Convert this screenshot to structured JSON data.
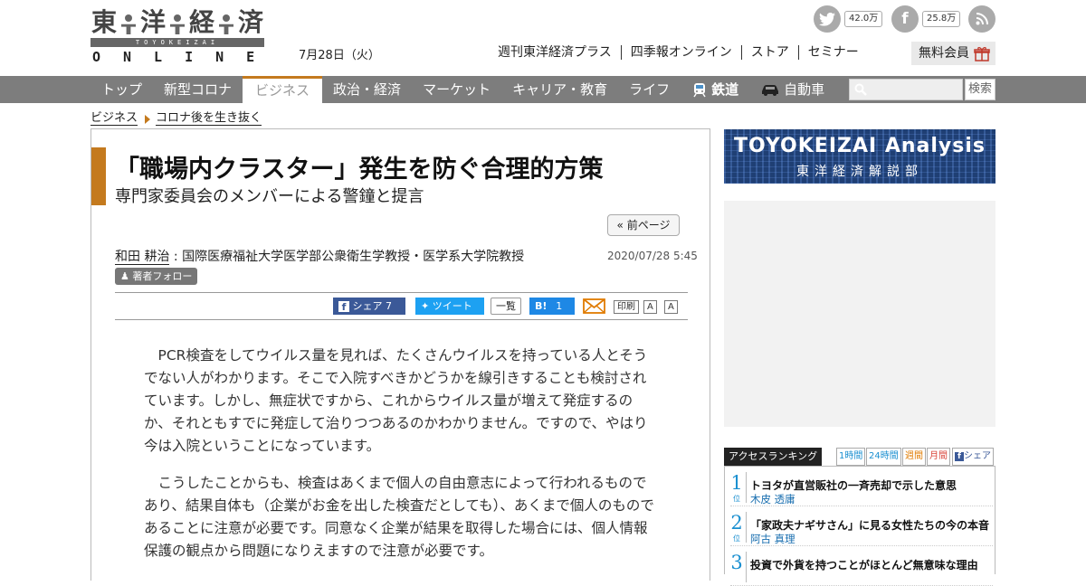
{
  "header": {
    "logo": {
      "chars": [
        "東",
        "洋",
        "経",
        "済"
      ],
      "roman": "TOYOKEIZAI",
      "sub": "ONLINE"
    },
    "date": "7月28日（火）",
    "links": [
      "週刊東洋経済プラス",
      "四季報オンライン",
      "ストア",
      "セミナー"
    ],
    "member_button": "無料会員",
    "social": [
      {
        "icon": "twitter-icon",
        "count": "42.0万"
      },
      {
        "icon": "facebook-icon",
        "count": "25.8万"
      },
      {
        "icon": "rss-icon",
        "count": ""
      }
    ]
  },
  "nav": {
    "items": [
      "トップ",
      "新型コロナ",
      "ビジネス",
      "政治・経済",
      "マーケット",
      "キャリア・教育",
      "ライフ",
      "鉄道",
      "自動車"
    ],
    "active_index": 2,
    "search_button": "検索"
  },
  "breadcrumb": [
    "ビジネス",
    "コロナ後を生き抜く"
  ],
  "article": {
    "title": "「職場内クラスター」発生を防ぐ合理的方策",
    "subtitle": "専門家委員会のメンバーによる警鐘と提言",
    "prev_button": "« 前ページ",
    "author_name": "和田 耕治",
    "author_affiliation": "国際医療福祉大学医学部公衆衛生学教授・医学系大学院教授",
    "date": "2020/07/28 5:45",
    "follow": "著者フォロー",
    "share": {
      "facebook": "シェア",
      "facebook_count": "7",
      "twitter": "ツイート",
      "list": "一覧",
      "hatena": "B!",
      "hatena_count": "1",
      "print": "印刷",
      "font_large": "A",
      "font_small": "A"
    },
    "paragraphs": [
      "PCR検査をしてウイルス量を見れば、たくさんウイルスを持っている人とそうでない人がわかります。そこで入院すべきかどうかを線引きすることも検討されています。しかし、無症状ですから、これからウイルス量が増えて発症するのか、それともすでに発症して治りつつあるのかわかりません。ですので、やはり今は入院ということになっています。",
      "こうしたことからも、検査はあくまで個人の自由意志によって行われるものであり、結果自体も（企業がお金を出した検査だとしても）、あくまで個人のものであることに注意が必要です。同意なく企業が結果を取得した場合には、個人情報保護の観点から問題になりえますので注意が必要です。"
    ]
  },
  "sidebar": {
    "ad_line1": "TOYOKEIZAI Analysis",
    "ad_line2": "東洋経済解説部",
    "ranking": {
      "title": "アクセスランキング",
      "tabs": [
        "1時間",
        "24時間",
        "週間",
        "月間",
        "シェア"
      ],
      "rank_suffix": "位",
      "items": [
        {
          "rank": "1",
          "title": "トヨタが直営販社の一斉売却で示した意思",
          "author": "木皮 透庸"
        },
        {
          "rank": "2",
          "title": "「家政夫ナギサさん」に見る女性たちの今の本音",
          "author": "阿古 真理"
        },
        {
          "rank": "3",
          "title": "投資で外貨を持つことがほとんど無意味な理由",
          "author": ""
        }
      ]
    }
  },
  "colors": {
    "accent": "#c47a1e",
    "nav_bg": "#7d7d7d",
    "facebook": "#3b5998",
    "twitter": "#1da1f2",
    "hatena": "#1e88e5",
    "rank": "#1a8fd0"
  }
}
